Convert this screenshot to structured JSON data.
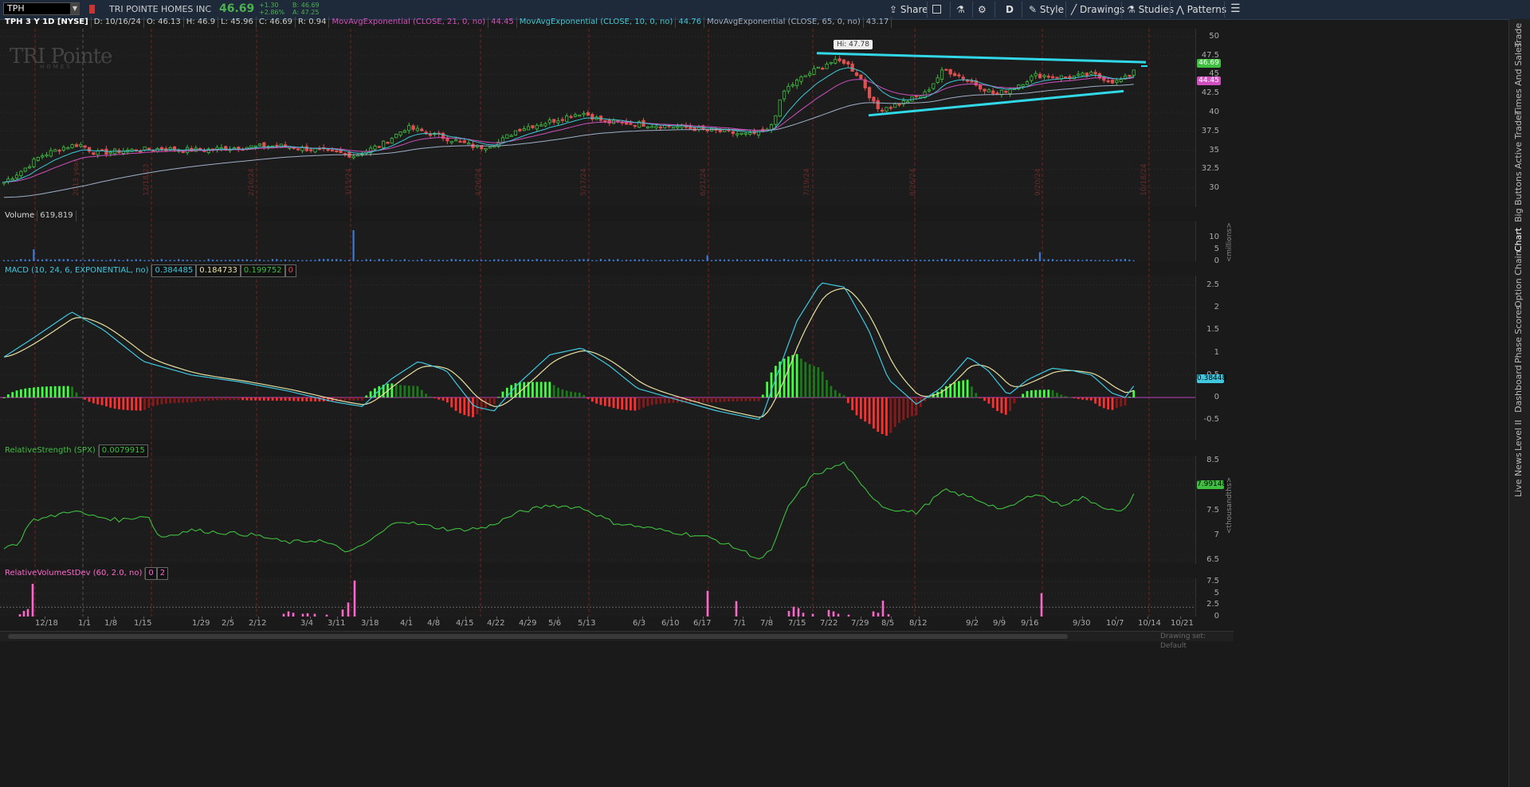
{
  "toolbar": {
    "symbol": "TPH",
    "company": "TRI POINTE HOMES INC",
    "last": "46.69",
    "change": "+1.30",
    "change_pct": "+2.86%",
    "bid": "B: 46.69",
    "ask": "A: 47.25",
    "buttons": {
      "share": "Share",
      "aggregation": "D",
      "style": "Style",
      "drawings": "Drawings",
      "studies": "Studies",
      "patterns": "Patterns"
    }
  },
  "header": {
    "title": "TPH 3 Y 1D [NYSE]",
    "date": "D: 10/16/24",
    "open": "O: 46.13",
    "high": "H: 46.9",
    "low": "L: 45.96",
    "close": "C: 46.69",
    "range": "R: 0.94",
    "ema21_label": "MovAvgExponential (CLOSE, 21, 0, no)",
    "ema21_value": "44.45",
    "ema10_label": "MovAvgExponential (CLOSE, 10, 0, no)",
    "ema10_value": "44.76",
    "ema65_label": "MovAvgExponential (CLOSE, 65, 0, no)",
    "ema65_value": "43.17"
  },
  "watermark": {
    "logo": "TRI Pointe",
    "sub": "HOMES"
  },
  "price_panel": {
    "hi_label": "Hi: 47.78",
    "price_tag": "46.69",
    "ema_tag": "44.45",
    "y_ticks": [
      "50",
      "47.5",
      "45",
      "42.5",
      "40",
      "37.5",
      "35",
      "32.5",
      "30"
    ],
    "event_labels": [
      "2013 year",
      "12/18/23",
      "2/16/24",
      "3/15/24",
      "4/26/24",
      "5/17/24",
      "6/21/24",
      "7/19/24",
      "8/26/24",
      "9/20/24",
      "10/18/24"
    ]
  },
  "volume_panel": {
    "label": "Volume",
    "value": "619,819",
    "y_ticks": [
      "10",
      "5",
      "0"
    ],
    "unit": "<millions>"
  },
  "macd_panel": {
    "label": "MACD (10, 24, 6, EXPONENTIAL, no)",
    "value": "0.384485",
    "avg": "0.184733",
    "diff": "0.199752",
    "zero": "0",
    "tag": "0.38448",
    "y_ticks": [
      "2.5",
      "2",
      "1.5",
      "1",
      "0.5",
      "0",
      "-0.5"
    ]
  },
  "rs_panel": {
    "label": "RelativeStrength (SPX)",
    "value": "0.0079915",
    "tag": "7.99148",
    "y_ticks": [
      "8.5",
      "8",
      "7.5",
      "7",
      "6.5"
    ],
    "unit": "<thousandths>"
  },
  "rv_panel": {
    "label": "RelativeVolumeStDev (60, 2.0, no)",
    "v1": "0",
    "v2": "2",
    "y_ticks": [
      "7.5",
      "5",
      "2.5",
      "0"
    ]
  },
  "x_axis": [
    "12/18",
    "1/1",
    "1/8",
    "1/15",
    "1/29",
    "2/5",
    "2/12",
    "3/4",
    "3/11",
    "3/18",
    "4/1",
    "4/8",
    "4/15",
    "4/22",
    "4/29",
    "5/6",
    "5/13",
    "6/3",
    "6/10",
    "6/17",
    "7/1",
    "7/8",
    "7/15",
    "7/22",
    "7/29",
    "8/5",
    "8/12",
    "9/2",
    "9/9",
    "9/16",
    "9/30",
    "10/7",
    "10/14",
    "10/21"
  ],
  "right_tabs": [
    "Trade",
    "Times And Sales",
    "Active Trader",
    "Big Buttons",
    "Chart",
    "Option Chain",
    "Phase Scores",
    "Dashboard",
    "Level II",
    "Live News"
  ],
  "footer": {
    "drawing_set": "Drawing set: Default"
  },
  "colors": {
    "up": "#3fbf3f",
    "down": "#e05050",
    "ema10": "#40c8d8",
    "ema21": "#d050c0",
    "ema65": "#9fb0c8",
    "trendline": "#30d8e8",
    "macd": "#40c8e0",
    "signal": "#e8e0a0",
    "rs": "#3fbf3f",
    "rv": "#ff66cc",
    "volume": "#3a7bd5"
  }
}
